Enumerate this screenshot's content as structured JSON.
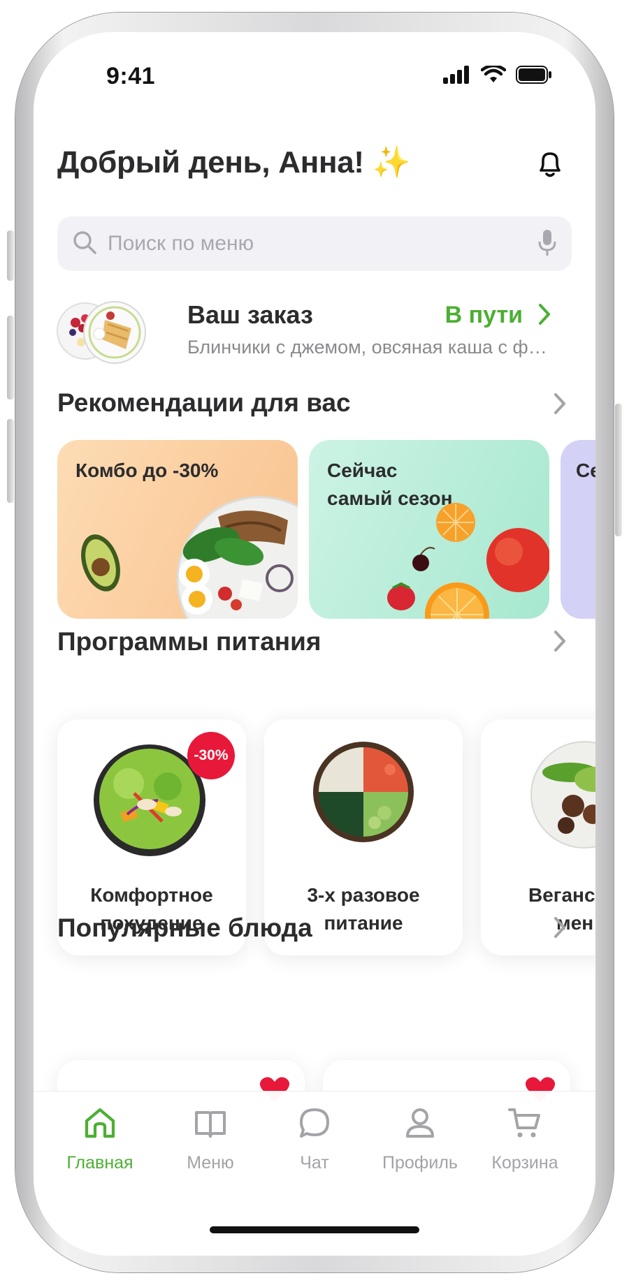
{
  "status_bar": {
    "time": "9:41"
  },
  "header": {
    "greeting": "Добрый день, Анна!",
    "greeting_emoji": "✨"
  },
  "search": {
    "placeholder": "Поиск по меню"
  },
  "order": {
    "title": "Ваш заказ",
    "status": "В пути",
    "description": "Блинчики с джемом, овсяная каша с фр..."
  },
  "recommendations": {
    "title": "Рекомендации для вас",
    "cards": [
      {
        "title": "Комбо до -30%"
      },
      {
        "title_line1": "Сейчас",
        "title_line2": "самый сезон"
      },
      {
        "title": "Се"
      }
    ]
  },
  "programs": {
    "title": "Программы питания",
    "cards": [
      {
        "line1": "Комфортное",
        "line2": "похудение",
        "badge": "-30%"
      },
      {
        "line1": "3-х разовое",
        "line2": "питание"
      },
      {
        "line1": "Веганс",
        "line2": "мен"
      }
    ]
  },
  "popular": {
    "title": "Популярные блюда"
  },
  "tabbar": {
    "items": [
      {
        "label": "Главная",
        "icon": "home-icon",
        "active": true
      },
      {
        "label": "Меню",
        "icon": "book-icon"
      },
      {
        "label": "Чат",
        "icon": "chat-icon"
      },
      {
        "label": "Профиль",
        "icon": "profile-icon"
      },
      {
        "label": "Корзина",
        "icon": "cart-icon"
      }
    ]
  },
  "colors": {
    "accent_green": "#4caf33",
    "badge_red": "#e8183a",
    "text_dark": "#2c2c2e",
    "text_muted": "#a3a3a8"
  }
}
